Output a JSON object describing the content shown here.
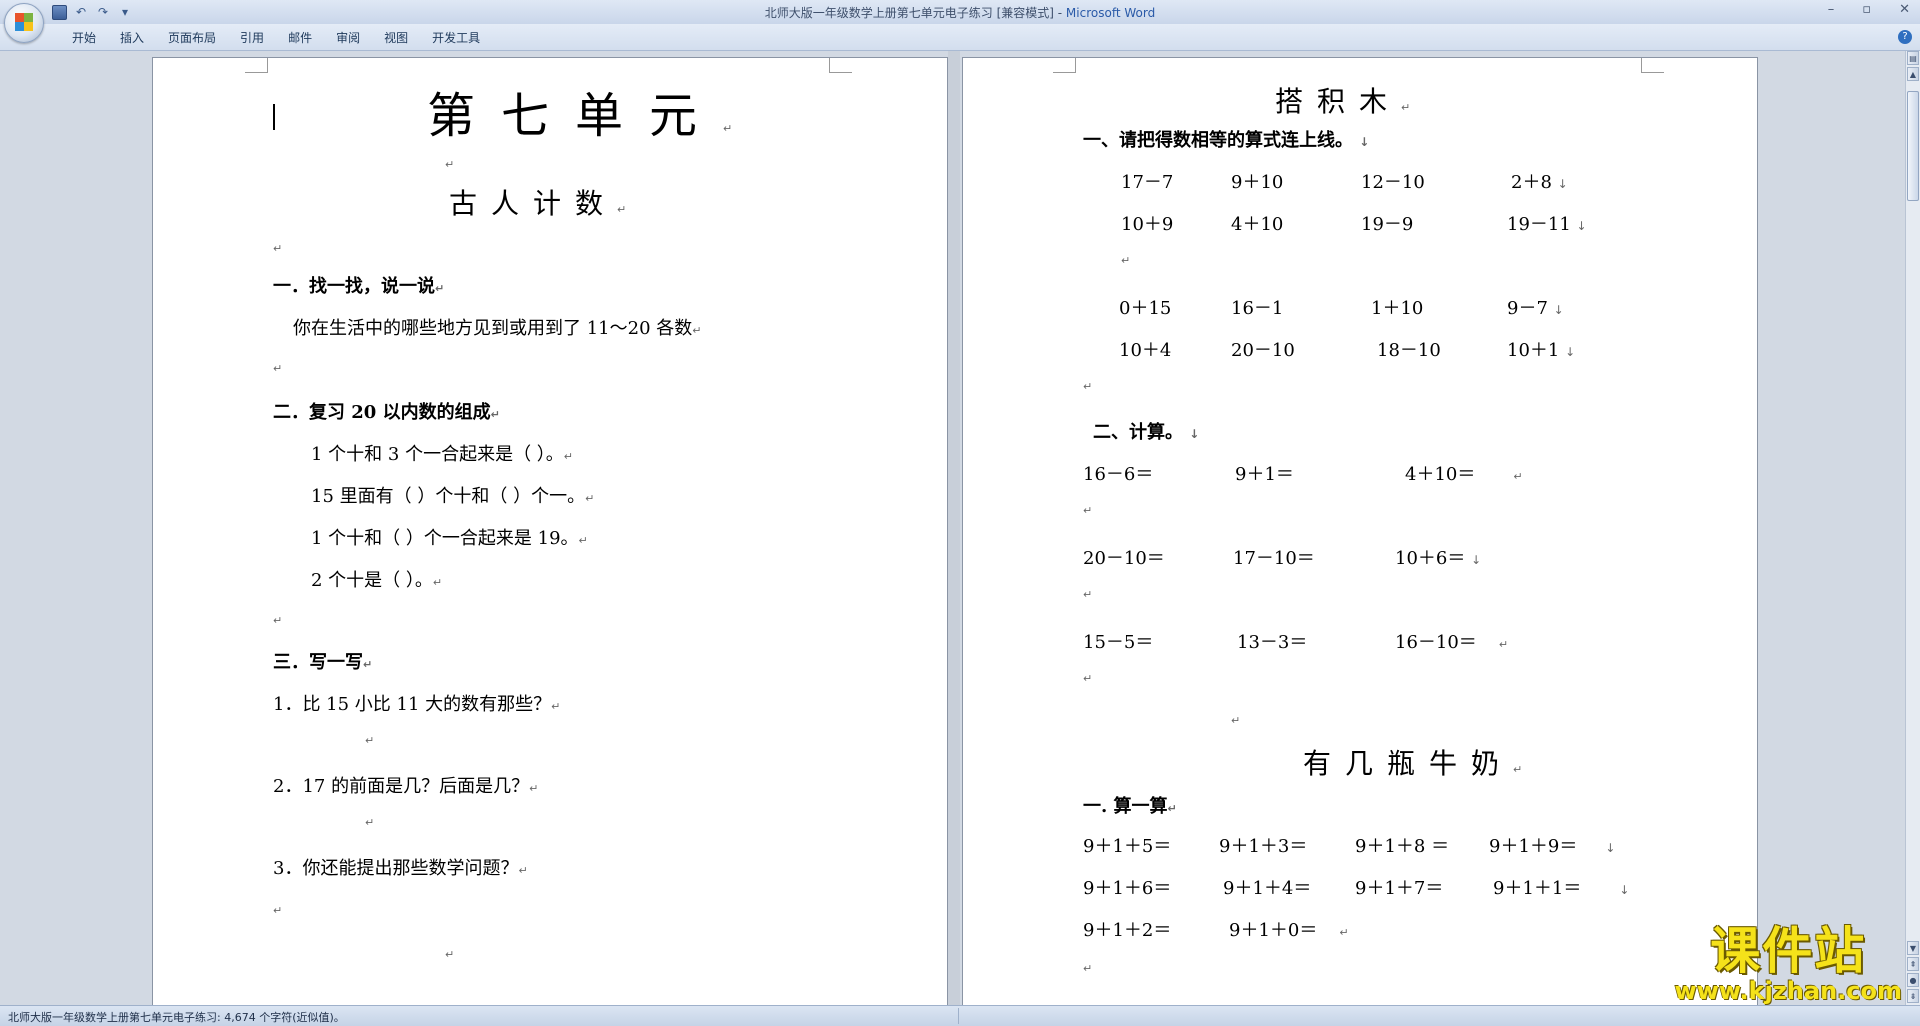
{
  "window": {
    "title": "北师大版一年级数学上册第七单元电子练习 [兼容模式] - ",
    "app_name": "Microsoft Word",
    "controls": [
      "–",
      "▫",
      "✕"
    ]
  },
  "ribbon": {
    "tabs": [
      "开始",
      "插入",
      "页面布局",
      "引用",
      "邮件",
      "审阅",
      "视图",
      "开发工具"
    ]
  },
  "left_page": {
    "unit_title": "第七单元",
    "lesson_title": "古人计数",
    "s1_heading": "一．找一找，说一说",
    "s1_text": "你在生活中的哪些地方见到或用到了 11～20 各数",
    "s2_heading": "二．复习 20 以内数的组成",
    "s2_items": [
      "1 个十和 3 个一合起来是（ ）。",
      "15 里面有（ ）个十和（ ）个一。",
      "1 个十和（ ）个一合起来是 19。",
      "2 个十是（ ）。"
    ],
    "s3_heading": "三．写一写",
    "s3_items": [
      "1．比 15 小比 11 大的数有那些？",
      "2．17 的前面是几？后面是几？",
      "3．你还能提出那些数学问题？"
    ]
  },
  "right_page": {
    "lesson1_title": "搭积木",
    "r1_heading": "一、请把得数相等的算式连上线。",
    "r1_rows": [
      [
        "17－7",
        "9＋10",
        "12－10",
        "2＋8"
      ],
      [
        "10＋9",
        "4＋10",
        "19－9",
        "19－11"
      ],
      [
        "0＋15",
        "16－1",
        "1＋10",
        "9－7"
      ],
      [
        "10＋4",
        "20－10",
        "18－10",
        "10＋1"
      ]
    ],
    "r2_heading": "二、计算。",
    "r2_rows": [
      [
        "16－6＝",
        "9＋1＝",
        "4＋10＝"
      ],
      [
        "20－10＝",
        "17－10＝",
        "10＋6＝"
      ],
      [
        "15－5＝",
        "13－3＝",
        "16－10＝"
      ]
    ],
    "lesson2_title": "有几瓶牛奶",
    "r3_heading": "一. 算一算",
    "r3_rows": [
      [
        "9＋1＋5＝",
        "9＋1＋3＝",
        "9＋1＋8 ＝",
        "9＋1＋9＝"
      ],
      [
        "9＋1＋6＝",
        "9＋1＋4＝",
        "9＋1＋7＝",
        "9＋1＋1＝"
      ],
      [
        "9＋1＋2＝",
        "9＋1＋0＝"
      ]
    ]
  },
  "marks": {
    "para": "↵",
    "line": "↓"
  },
  "status": {
    "text": "北师大版一年级数学上册第七单元电子练习: 4,674 个字符(近似值)。"
  },
  "watermark": {
    "main": "课件站",
    "url": "www.kjzhan.com"
  },
  "colors": {
    "app_name": "#2a5aa8",
    "watermark": "#f5e21a"
  }
}
